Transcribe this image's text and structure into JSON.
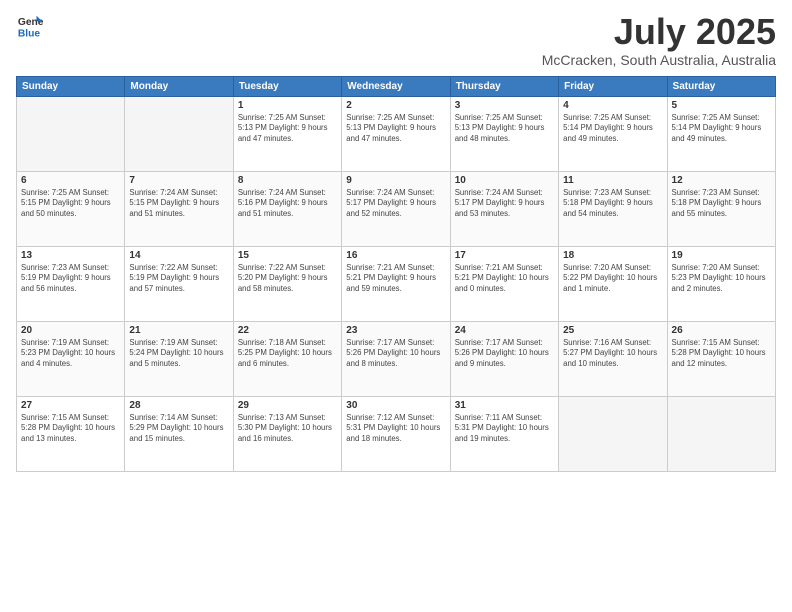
{
  "header": {
    "logo_line1": "General",
    "logo_line2": "Blue",
    "title": "July 2025",
    "subtitle": "McCracken, South Australia, Australia"
  },
  "days_of_week": [
    "Sunday",
    "Monday",
    "Tuesday",
    "Wednesday",
    "Thursday",
    "Friday",
    "Saturday"
  ],
  "weeks": [
    [
      {
        "day": "",
        "info": ""
      },
      {
        "day": "",
        "info": ""
      },
      {
        "day": "1",
        "info": "Sunrise: 7:25 AM\nSunset: 5:13 PM\nDaylight: 9 hours and 47 minutes."
      },
      {
        "day": "2",
        "info": "Sunrise: 7:25 AM\nSunset: 5:13 PM\nDaylight: 9 hours and 47 minutes."
      },
      {
        "day": "3",
        "info": "Sunrise: 7:25 AM\nSunset: 5:13 PM\nDaylight: 9 hours and 48 minutes."
      },
      {
        "day": "4",
        "info": "Sunrise: 7:25 AM\nSunset: 5:14 PM\nDaylight: 9 hours and 49 minutes."
      },
      {
        "day": "5",
        "info": "Sunrise: 7:25 AM\nSunset: 5:14 PM\nDaylight: 9 hours and 49 minutes."
      }
    ],
    [
      {
        "day": "6",
        "info": "Sunrise: 7:25 AM\nSunset: 5:15 PM\nDaylight: 9 hours and 50 minutes."
      },
      {
        "day": "7",
        "info": "Sunrise: 7:24 AM\nSunset: 5:15 PM\nDaylight: 9 hours and 51 minutes."
      },
      {
        "day": "8",
        "info": "Sunrise: 7:24 AM\nSunset: 5:16 PM\nDaylight: 9 hours and 51 minutes."
      },
      {
        "day": "9",
        "info": "Sunrise: 7:24 AM\nSunset: 5:17 PM\nDaylight: 9 hours and 52 minutes."
      },
      {
        "day": "10",
        "info": "Sunrise: 7:24 AM\nSunset: 5:17 PM\nDaylight: 9 hours and 53 minutes."
      },
      {
        "day": "11",
        "info": "Sunrise: 7:23 AM\nSunset: 5:18 PM\nDaylight: 9 hours and 54 minutes."
      },
      {
        "day": "12",
        "info": "Sunrise: 7:23 AM\nSunset: 5:18 PM\nDaylight: 9 hours and 55 minutes."
      }
    ],
    [
      {
        "day": "13",
        "info": "Sunrise: 7:23 AM\nSunset: 5:19 PM\nDaylight: 9 hours and 56 minutes."
      },
      {
        "day": "14",
        "info": "Sunrise: 7:22 AM\nSunset: 5:19 PM\nDaylight: 9 hours and 57 minutes."
      },
      {
        "day": "15",
        "info": "Sunrise: 7:22 AM\nSunset: 5:20 PM\nDaylight: 9 hours and 58 minutes."
      },
      {
        "day": "16",
        "info": "Sunrise: 7:21 AM\nSunset: 5:21 PM\nDaylight: 9 hours and 59 minutes."
      },
      {
        "day": "17",
        "info": "Sunrise: 7:21 AM\nSunset: 5:21 PM\nDaylight: 10 hours and 0 minutes."
      },
      {
        "day": "18",
        "info": "Sunrise: 7:20 AM\nSunset: 5:22 PM\nDaylight: 10 hours and 1 minute."
      },
      {
        "day": "19",
        "info": "Sunrise: 7:20 AM\nSunset: 5:23 PM\nDaylight: 10 hours and 2 minutes."
      }
    ],
    [
      {
        "day": "20",
        "info": "Sunrise: 7:19 AM\nSunset: 5:23 PM\nDaylight: 10 hours and 4 minutes."
      },
      {
        "day": "21",
        "info": "Sunrise: 7:19 AM\nSunset: 5:24 PM\nDaylight: 10 hours and 5 minutes."
      },
      {
        "day": "22",
        "info": "Sunrise: 7:18 AM\nSunset: 5:25 PM\nDaylight: 10 hours and 6 minutes."
      },
      {
        "day": "23",
        "info": "Sunrise: 7:17 AM\nSunset: 5:26 PM\nDaylight: 10 hours and 8 minutes."
      },
      {
        "day": "24",
        "info": "Sunrise: 7:17 AM\nSunset: 5:26 PM\nDaylight: 10 hours and 9 minutes."
      },
      {
        "day": "25",
        "info": "Sunrise: 7:16 AM\nSunset: 5:27 PM\nDaylight: 10 hours and 10 minutes."
      },
      {
        "day": "26",
        "info": "Sunrise: 7:15 AM\nSunset: 5:28 PM\nDaylight: 10 hours and 12 minutes."
      }
    ],
    [
      {
        "day": "27",
        "info": "Sunrise: 7:15 AM\nSunset: 5:28 PM\nDaylight: 10 hours and 13 minutes."
      },
      {
        "day": "28",
        "info": "Sunrise: 7:14 AM\nSunset: 5:29 PM\nDaylight: 10 hours and 15 minutes."
      },
      {
        "day": "29",
        "info": "Sunrise: 7:13 AM\nSunset: 5:30 PM\nDaylight: 10 hours and 16 minutes."
      },
      {
        "day": "30",
        "info": "Sunrise: 7:12 AM\nSunset: 5:31 PM\nDaylight: 10 hours and 18 minutes."
      },
      {
        "day": "31",
        "info": "Sunrise: 7:11 AM\nSunset: 5:31 PM\nDaylight: 10 hours and 19 minutes."
      },
      {
        "day": "",
        "info": ""
      },
      {
        "day": "",
        "info": ""
      }
    ]
  ]
}
